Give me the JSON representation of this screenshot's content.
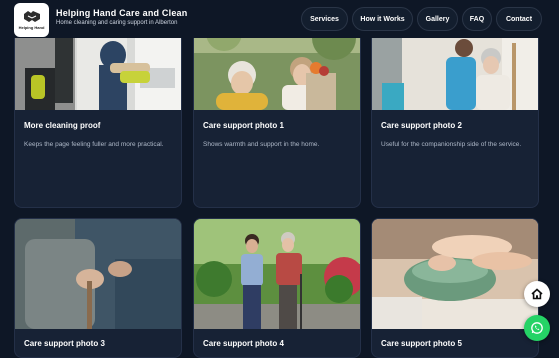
{
  "brand": {
    "name": "Helping Hand Care and Clean",
    "tagline": "Home cleaning and caring support in Alberton",
    "logo_text": "Helping Hand"
  },
  "nav": [
    {
      "label": "Services"
    },
    {
      "label": "How it Works"
    },
    {
      "label": "Gallery"
    },
    {
      "label": "FAQ"
    },
    {
      "label": "Contact"
    }
  ],
  "gallery": [
    {
      "title": "More cleaning proof",
      "desc": "Keeps the page feeling fuller and more practical."
    },
    {
      "title": "Care support photo 1",
      "desc": "Shows warmth and support in the home."
    },
    {
      "title": "Care support photo 2",
      "desc": "Useful for the companionship side of the service."
    },
    {
      "title": "Care support photo 3",
      "desc": ""
    },
    {
      "title": "Care support photo 4",
      "desc": ""
    },
    {
      "title": "Care support photo 5",
      "desc": ""
    }
  ],
  "floating": {
    "home_icon": "home-icon",
    "whatsapp_icon": "whatsapp-icon",
    "whatsapp_color": "#25d366"
  }
}
